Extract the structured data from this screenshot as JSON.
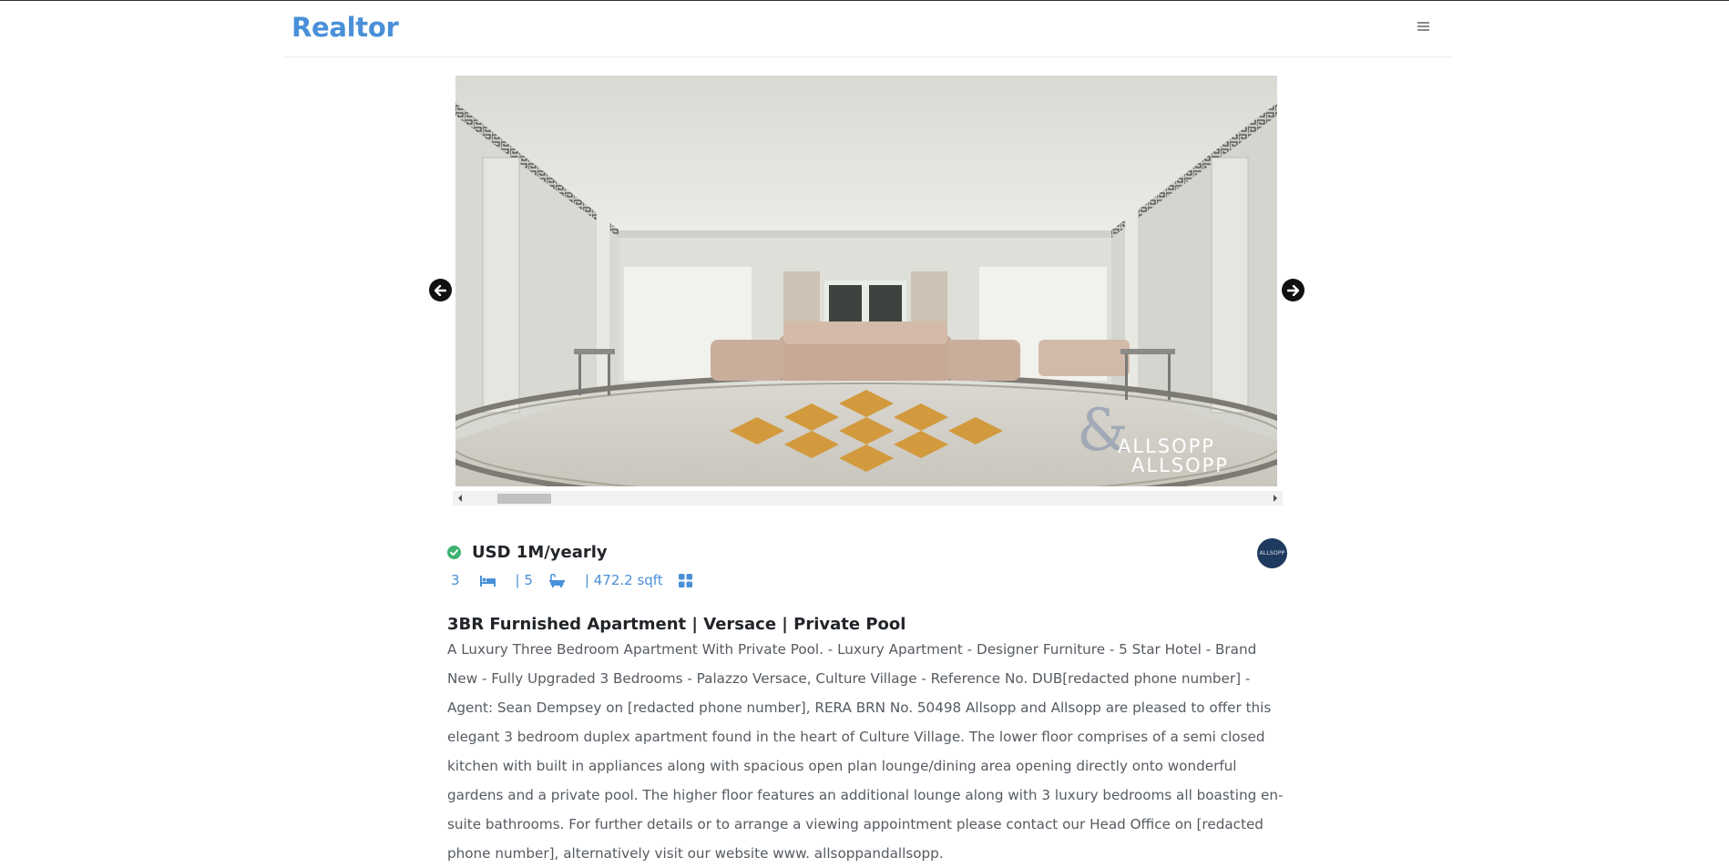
{
  "header": {
    "brand": "Realtor",
    "menu_icon": "hamburger-icon"
  },
  "gallery": {
    "photo_description_icon": "property-photo",
    "watermark_line1": "ALLSOPP",
    "watermark_line2": "ALLSOPP",
    "prev_icon": "arrow-left-icon",
    "next_icon": "arrow-right-icon",
    "scroll_position": 0.04
  },
  "listing": {
    "verified_icon": "check-circle-icon",
    "price": "USD 1M/yearly",
    "bedrooms": "3",
    "bedroom_icon": "bed-icon",
    "bathrooms": "| 5",
    "bathroom_icon": "bath-icon",
    "area": "| 472.2 sqft",
    "area_icon": "grid-icon",
    "title": "3BR Furnished Apartment | Versace | Private Pool",
    "description": "A Luxury Three Bedroom Apartment With Private Pool. - Luxury Apartment - Designer Furniture - 5 Star Hotel - Brand New - Fully Upgraded 3 Bedrooms - Palazzo Versace, Culture Village - Reference No. DUB[redacted phone number] - Agent: Sean Dempsey on [redacted phone number], RERA BRN No. 50498 Allsopp and Allsopp are pleased to offer this elegant 3 bedroom duplex apartment found in the heart of Culture Village. The lower floor comprises of a semi closed kitchen with built in appliances along with spacious open plan lounge/dining area opening directly onto wonderful gardens and a private pool. The higher floor features an additional lounge along with 3 luxury bedrooms all boasting en-suite bathrooms. For further details or to arrange a viewing appointment please contact our Head Office on [redacted phone number], alternatively visit our website www. allsoppandallsopp.",
    "agency_logo_text": "ALLSOPP"
  },
  "colors": {
    "brand": "#4a90d9",
    "verified": "#3cb371",
    "text": "#212529",
    "muted": "#555b61"
  }
}
